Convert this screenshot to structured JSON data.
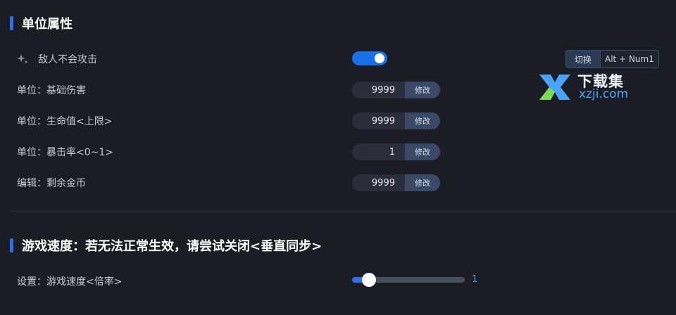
{
  "section1": {
    "title": "单位属性",
    "rows": [
      {
        "label": "敌人不会攻击",
        "control": "toggle",
        "enabled": true
      },
      {
        "label": "单位：基础伤害",
        "value": "9999",
        "button": "修改"
      },
      {
        "label": "单位：生命值<上限>",
        "value": "9999",
        "button": "修改"
      },
      {
        "label": "单位：暴击率<0~1>",
        "value": "1",
        "button": "修改"
      },
      {
        "label": "编辑：剩余金币",
        "value": "9999",
        "button": "修改"
      }
    ],
    "hotkey": {
      "action": "切换",
      "keys": "Alt + Num1"
    }
  },
  "section2": {
    "title": "游戏速度：若无法正常生效，请尝试关闭<垂直同步>",
    "slider": {
      "label": "设置：游戏速度<倍率>",
      "value": "1",
      "fraction": 0.15
    }
  },
  "watermark": {
    "text_zh": "下载集",
    "text_en": "xzji.com"
  },
  "colors": {
    "accent": "#2f6fe8",
    "toggle_on": "#1b6fe6",
    "button_bg": "#3a4a66",
    "background": "#1b1d24"
  }
}
